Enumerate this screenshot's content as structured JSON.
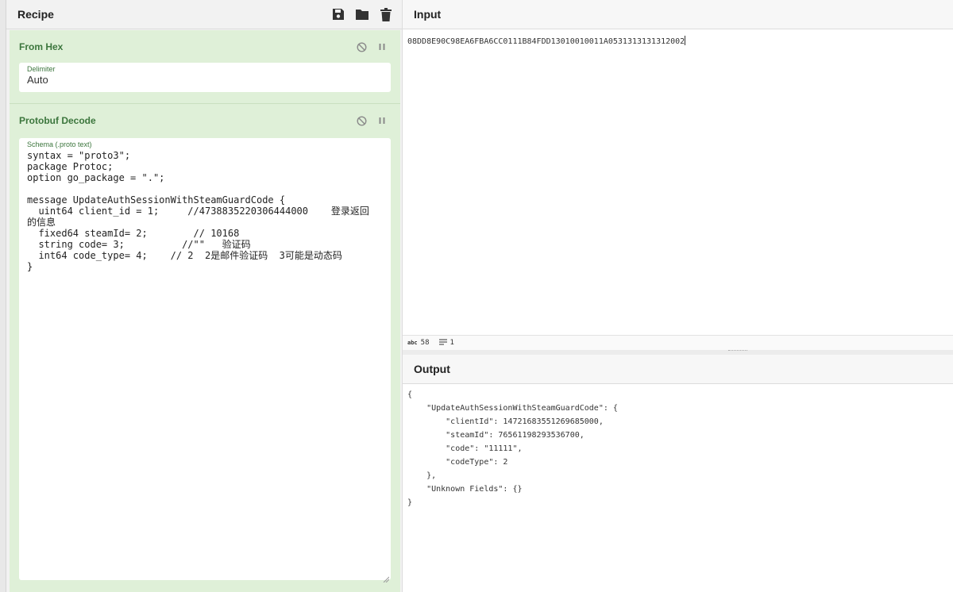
{
  "recipe": {
    "title": "Recipe",
    "icons": [
      "save-icon",
      "folder-icon",
      "trash-icon"
    ],
    "operations": [
      {
        "title": "From Hex",
        "field_label": "Delimiter",
        "field_value": "Auto"
      },
      {
        "title": "Protobuf Decode",
        "field_label": "Schema (.proto text)",
        "field_value": "syntax = \"proto3\";\npackage Protoc;\noption go_package = \".\";\n\nmessage UpdateAuthSessionWithSteamGuardCode {\n  uint64 client_id = 1;     //4738835220306444000    登录返回的信息\n  fixed64 steamId= 2;        // 10168\n  string code= 3;          //\"\"   验证码\n  int64 code_type= 4;    // 2  2是邮件验证码  3可能是动态码\n}"
      }
    ]
  },
  "input": {
    "title": "Input",
    "value": "08DD8E90C98EA6FBA6CC0111B84FDD13010010011A0531313131312002",
    "status": {
      "length_label": "58",
      "lines_label": "1"
    }
  },
  "output": {
    "title": "Output",
    "value": "{\n    \"UpdateAuthSessionWithSteamGuardCode\": {\n        \"clientId\": 14721683551269685000,\n        \"steamId\": 76561198293536700,\n        \"code\": \"11111\",\n        \"codeType\": 2\n    },\n    \"Unknown Fields\": {}\n}"
  },
  "colors": {
    "op_background": "#dff0d8",
    "op_title": "#3c763d",
    "panel_background": "#f2f2f2"
  }
}
